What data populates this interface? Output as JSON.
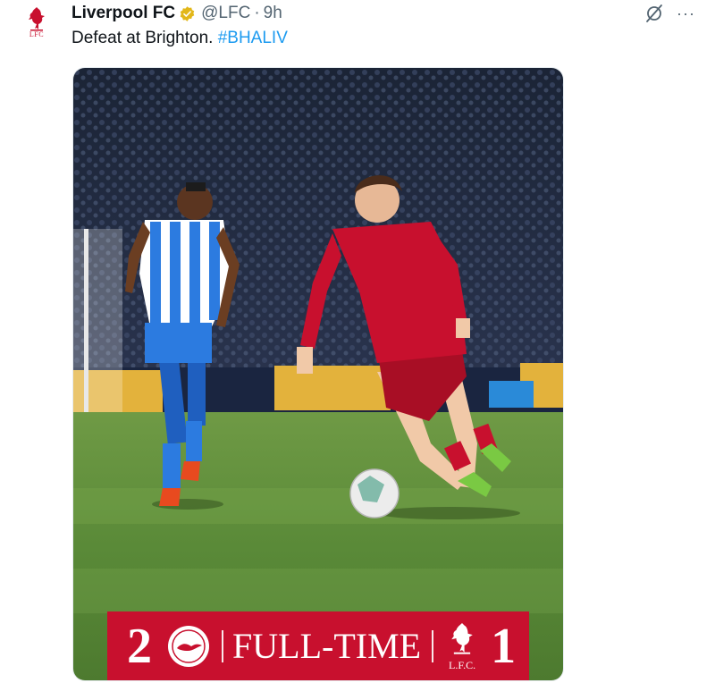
{
  "tweet": {
    "display_name": "Liverpool FC",
    "handle": "@LFC",
    "separator": "·",
    "time": "9h",
    "text": "Defeat at Brighton.",
    "hashtag": "#BHALIV",
    "avatar_text": "LFC",
    "verified_icon": "verified-badge-icon",
    "grok_icon": "grok-icon",
    "more_label": "···"
  },
  "media": {
    "kind": "match-photo",
    "scoreboard": {
      "home_score": "2",
      "status": "FULL-TIME",
      "away_score": "1",
      "away_badge_text": "L.F.C."
    }
  },
  "colors": {
    "lfc_red": "#c8102e",
    "link_blue": "#1d9bf0",
    "verified_gold": "#e2b719",
    "muted_text": "#536471"
  }
}
